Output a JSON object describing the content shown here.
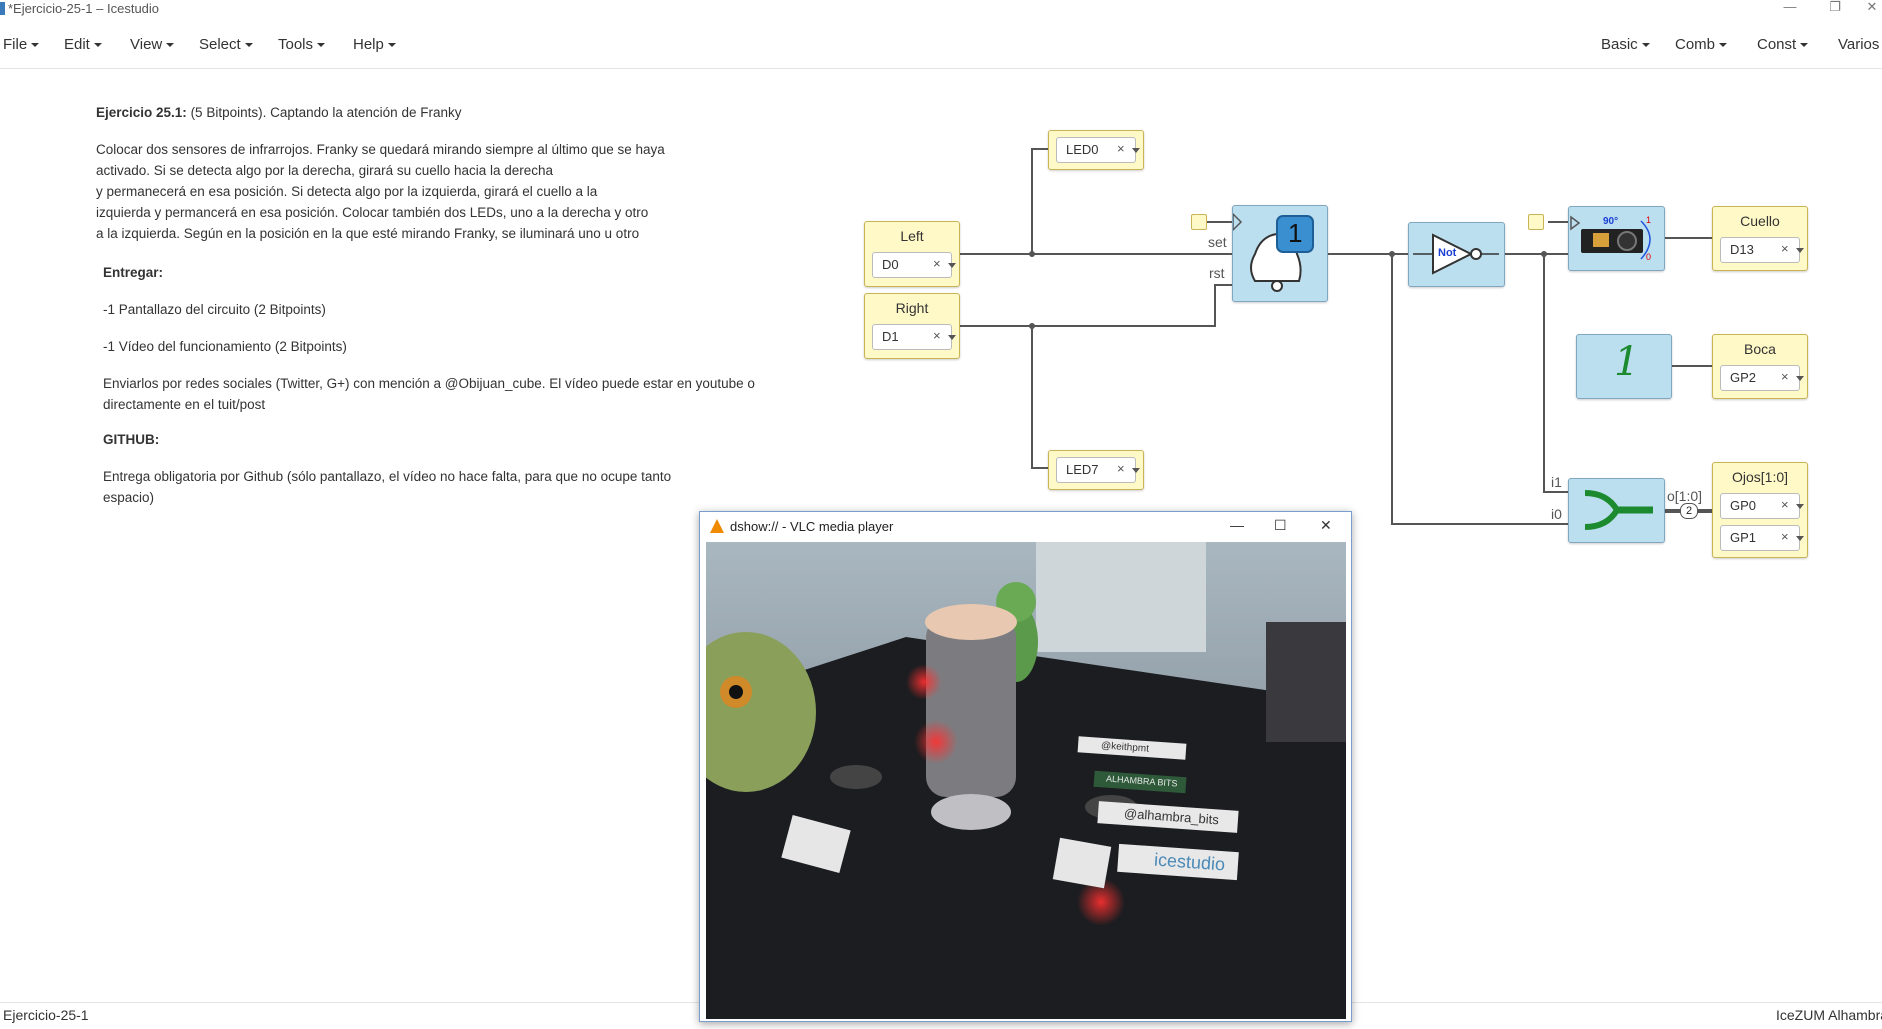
{
  "window": {
    "title": "*Ejercicio-25-1 – Icestudio"
  },
  "menu": {
    "left": [
      "File",
      "Edit",
      "View",
      "Select",
      "Tools",
      "Help"
    ],
    "right": [
      "Basic",
      "Comb",
      "Const",
      "Varios"
    ]
  },
  "instructions": {
    "heading_bold": "Ejercicio 25.1:",
    "heading_rest": " (5 Bitpoints). Captando la atención de Franky",
    "paragraph": [
      "Colocar dos sensores de infrarrojos. Franky se quedará mirando siempre al último que se haya",
      "activado. Si se detecta algo por la derecha, girará su cuello hacia la derecha",
      "y permanecerá en esa posición. Si detecta algo por la izquierda, girará el cuello a la",
      "izquierda y permancerá en esa posición. Colocar también dos LEDs, uno a la derecha y otro",
      "a la izquierda. Según en la posición en la que esté mirando Franky, se iluminará uno u otro"
    ],
    "entregar": "Entregar:",
    "item1": "-1 Pantallazo del circuito (2 Bitpoints)",
    "item2": "-1 Vídeo del funcionamiento (2 Bitpoints)",
    "social": [
      "Enviarlos por redes sociales (Twitter, G+) con mención a @Obijuan_cube. El vídeo puede estar en youtube o",
      "directamente en el tuit/post"
    ],
    "github": "GITHUB:",
    "github_text": [
      "Entrega obligatoria por Github (sólo pantallazo, el vídeo no hace falta, para que no ocupe tanto",
      "espacio)"
    ]
  },
  "circuit": {
    "inputs": [
      {
        "label": "Left",
        "pin": "D0"
      },
      {
        "label": "Right",
        "pin": "D1"
      }
    ],
    "leds": [
      {
        "pin": "LED0"
      },
      {
        "pin": "LED7"
      }
    ],
    "outputs": [
      {
        "label": "Cuello",
        "pin": "D13"
      },
      {
        "label": "Boca",
        "pin": "GP2"
      },
      {
        "label": "Ojos[1:0]",
        "pins": [
          "GP0",
          "GP1"
        ]
      }
    ],
    "flipflop": {
      "set_label": "set",
      "rst_label": "rst",
      "badge": "1"
    },
    "not_gate": {
      "label": "Not"
    },
    "servo": {
      "angle": "90°",
      "mark_high": "1",
      "mark_low": "0"
    },
    "const_block": {
      "value": "1"
    },
    "bus": {
      "in1": "i1",
      "in0": "i0",
      "out": "o[1:0]",
      "width": "2"
    },
    "remove_glyph": "×"
  },
  "vlc": {
    "title": "dshow:// - VLC media player",
    "stickers": [
      "@keithpmt",
      "ALHAMBRA BITS",
      "@alhambra_bits",
      "icestudio"
    ]
  },
  "status": {
    "left": "Ejercicio-25-1",
    "right": "IceZUM Alhambra"
  }
}
